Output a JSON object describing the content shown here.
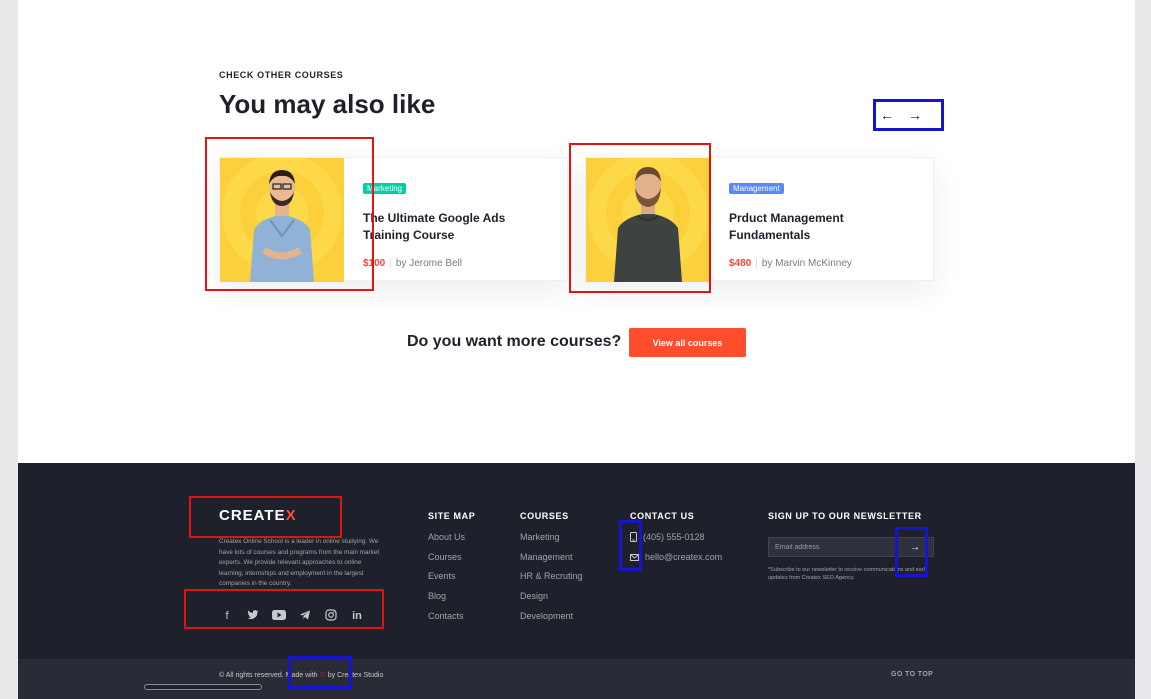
{
  "section": {
    "eyebrow": "CHECK OTHER COURSES",
    "title": "You may also like",
    "prev_icon": "←",
    "next_icon": "→"
  },
  "courses": [
    {
      "badge": "Marketing",
      "badge_color": "#03cea4",
      "title": "The Ultimate Google Ads Training Course",
      "price": "$100",
      "author": "by Jerome Bell"
    },
    {
      "badge": "Management",
      "badge_color": "#5a87fc",
      "title": "Prduct Management Fundamentals",
      "price": "$480",
      "author": "by Marvin McKinney"
    }
  ],
  "cta": {
    "question": "Do you want more courses?",
    "button": "View all courses"
  },
  "footer": {
    "logo_text": "CREATE",
    "logo_x": "X",
    "about": "Createx Online School is a leader in online studying. We have lots of courses and programs from the main market experts. We provide relevant approaches to online learning, internships and employment in the largest companies in the country.",
    "social": [
      "facebook-icon",
      "twitter-icon",
      "youtube-icon",
      "telegram-icon",
      "instagram-icon",
      "linkedin-icon"
    ],
    "sitemap": {
      "heading": "SITE MAP",
      "items": [
        "About Us",
        "Courses",
        "Events",
        "Blog",
        "Contacts"
      ]
    },
    "courses": {
      "heading": "COURSES",
      "items": [
        "Marketing",
        "Management",
        "HR & Recruting",
        "Design",
        "Development"
      ]
    },
    "contact": {
      "heading": "CONTACT US",
      "phone": "(405) 555-0128",
      "email": "hello@createx.com"
    },
    "newsletter": {
      "heading": "SIGN UP TO OUR NEWSLETTER",
      "placeholder": "Email address",
      "submit_icon": "→",
      "disclaimer": "*Subscribe to our newsletter to receive communications and early updates from Createx SEO Agency."
    },
    "copyright_prefix": "© All rights reserved. Made with",
    "heart": "♡",
    "copyright_suffix": "by Createx Studio",
    "go_to_top": "GO TO TOP"
  },
  "colors": {
    "accent": "#ff4d2e",
    "price": "#ff3f3a",
    "footer_bg": "#1e212c",
    "card_image_bg": "#fbd03c"
  }
}
